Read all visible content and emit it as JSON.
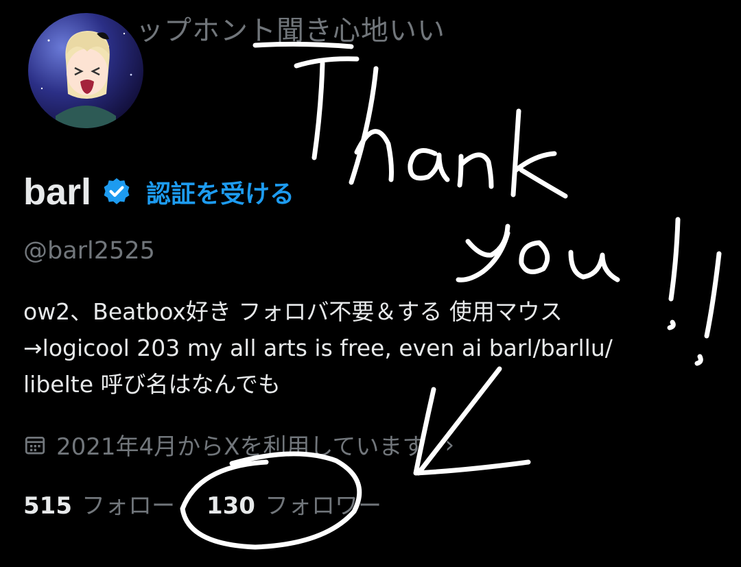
{
  "header": {
    "banner_text": "ップホント聞き心地いい"
  },
  "profile": {
    "display_name": "barl",
    "verify_link": "認証を受ける",
    "handle": "@barl2525",
    "bio_lines": [
      "ow2、Beatbox好き フォロバ不要＆する 使用マウス",
      "→logicool 203 my all arts is free, even ai barl/barllu/",
      "libelte 呼び名はなんでも"
    ],
    "joined": "2021年4月からXを利用しています",
    "following_count": "515",
    "following_label": "フォロー",
    "followers_count": "130",
    "followers_label": "フォロワー"
  },
  "icons": {
    "verified": "verified-badge-icon",
    "calendar": "calendar-icon",
    "chevron": "chevron-right-icon"
  },
  "colors": {
    "background": "#000000",
    "text_primary": "#e7e9ea",
    "text_secondary": "#71767b",
    "accent": "#1d9bf0",
    "annotation": "#ffffff"
  }
}
